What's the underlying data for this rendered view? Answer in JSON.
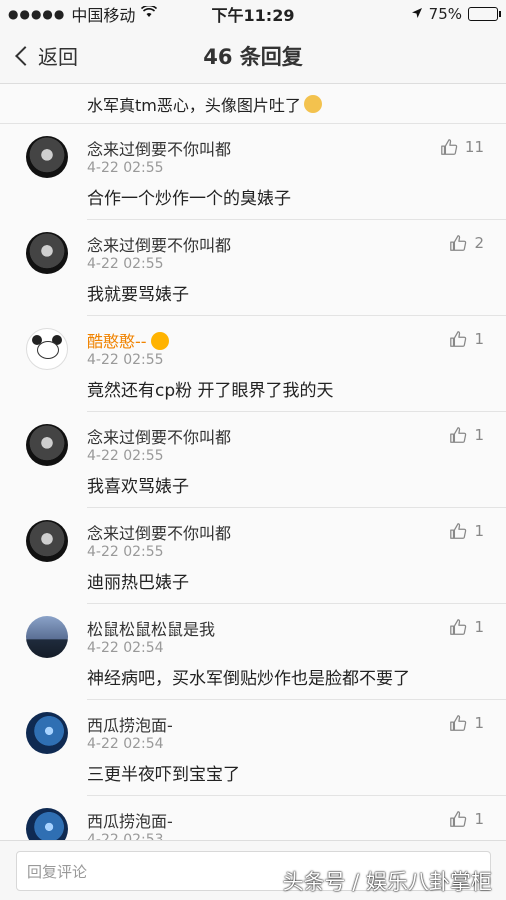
{
  "status_bar": {
    "carrier": "中国移动",
    "time": "下午11:29",
    "battery": "75%",
    "battery_level": 0.75
  },
  "nav": {
    "back_label": "返回",
    "title": "46 条回复"
  },
  "partial_comment": {
    "text": "水军真tm恶心，头像图片吐了"
  },
  "comments": [
    {
      "username": "念来过倒要不你叫都",
      "date": "4-22 02:55",
      "text": "合作一个炒作一个的臭婊子",
      "likes": "11",
      "avatar": "dark-portrait"
    },
    {
      "username": "念来过倒要不你叫都",
      "date": "4-22 02:55",
      "text": "我就要骂婊子",
      "likes": "2",
      "avatar": "dark-portrait"
    },
    {
      "username": "酷憨憨--",
      "date": "4-22 02:55",
      "text": "竟然还有cp粉 开了眼界了我的天",
      "likes": "1",
      "avatar": "panda",
      "name_color": "#f08300"
    },
    {
      "username": "念来过倒要不你叫都",
      "date": "4-22 02:55",
      "text": "我喜欢骂婊子",
      "likes": "1",
      "avatar": "dark-portrait"
    },
    {
      "username": "念来过倒要不你叫都",
      "date": "4-22 02:55",
      "text": "迪丽热巴婊子",
      "likes": "1",
      "avatar": "dark-portrait"
    },
    {
      "username": "松鼠松鼠松鼠是我",
      "date": "4-22 02:54",
      "text": "神经病吧，买水军倒贴炒作也是脸都不要了",
      "likes": "1",
      "avatar": "night-city"
    },
    {
      "username": "西瓜捞泡面-",
      "date": "4-22 02:54",
      "text": "三更半夜吓到宝宝了",
      "likes": "1",
      "avatar": "blue-graphic"
    },
    {
      "username": "西瓜捞泡面-",
      "date": "4-22 02:53",
      "text": "",
      "likes": "1",
      "avatar": "blue-graphic"
    }
  ],
  "reply_input": {
    "placeholder": "回复评论"
  },
  "watermark": "头条号 / 娱乐八卦掌柜"
}
